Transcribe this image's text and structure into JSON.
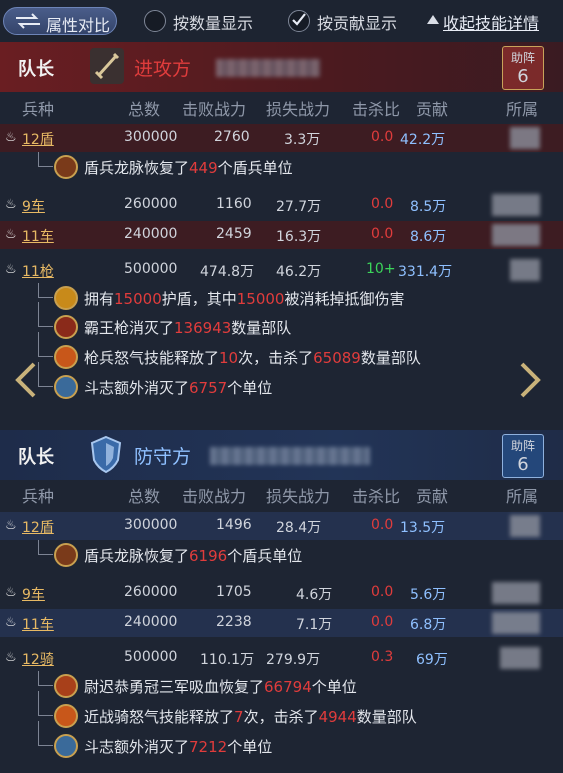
{
  "topbar": {
    "attr_compare": "属性对比",
    "by_count": "按数量显示",
    "by_contrib": "按贡献显示",
    "collapse": "收起技能详情"
  },
  "columns": [
    "兵种",
    "总数",
    "击败战力",
    "损失战力",
    "击杀比",
    "贡献",
    "所属"
  ],
  "attacker": {
    "captain": "队长",
    "side": "进攻方",
    "assist_label": "助阵",
    "assist_count": "6",
    "rows": [
      {
        "unit": "12盾",
        "total": "300000",
        "defeated": "2760",
        "lost": "3.3万",
        "ratio": "0.0",
        "contrib": "42.2万"
      },
      {
        "unit": "9车",
        "total": "260000",
        "defeated": "1160",
        "lost": "27.7万",
        "ratio": "0.0",
        "contrib": "8.5万"
      },
      {
        "unit": "11车",
        "total": "240000",
        "defeated": "2459",
        "lost": "16.3万",
        "ratio": "0.0",
        "contrib": "8.6万"
      },
      {
        "unit": "11枪",
        "total": "500000",
        "defeated": "474.8万",
        "lost": "46.2万",
        "ratio": "10+",
        "contrib": "331.4万"
      }
    ],
    "shield_skill": {
      "pre": "盾兵龙脉恢复了",
      "num": "449",
      "post": "个盾兵单位"
    },
    "spear_skills": [
      {
        "pre": "拥有",
        "num": "15000",
        "mid": "护盾，其中",
        "num2": "15000",
        "post": "被消耗掉抵御伤害"
      },
      {
        "pre": "霸王枪消灭了",
        "num": "136943",
        "post": "数量部队"
      },
      {
        "pre": "枪兵怒气技能释放了",
        "num": "10",
        "mid": "次，击杀了",
        "num2": "65089",
        "post": "数量部队"
      },
      {
        "pre": "斗志额外消灭了",
        "num": "6757",
        "post": "个单位"
      }
    ]
  },
  "defender": {
    "captain": "队长",
    "side": "防守方",
    "assist_label": "助阵",
    "assist_count": "6",
    "rows": [
      {
        "unit": "12盾",
        "total": "300000",
        "defeated": "1496",
        "lost": "28.4万",
        "ratio": "0.0",
        "contrib": "13.5万"
      },
      {
        "unit": "9车",
        "total": "260000",
        "defeated": "1705",
        "lost": "4.6万",
        "ratio": "0.0",
        "contrib": "5.6万"
      },
      {
        "unit": "11车",
        "total": "240000",
        "defeated": "2238",
        "lost": "7.1万",
        "ratio": "0.0",
        "contrib": "6.8万"
      },
      {
        "unit": "12骑",
        "total": "500000",
        "defeated": "110.1万",
        "lost": "279.9万",
        "ratio": "0.3",
        "contrib": "69万"
      }
    ],
    "shield_skill": {
      "pre": "盾兵龙脉恢复了",
      "num": "6196",
      "post": "个盾兵单位"
    },
    "cav_skills": [
      {
        "pre": "尉迟恭勇冠三军吸血恢复了",
        "num": "66794",
        "post": "个单位"
      },
      {
        "pre": "近战骑怒气技能释放了",
        "num": "7",
        "mid": "次，击杀了",
        "num2": "4944",
        "post": "数量部队"
      },
      {
        "pre": "斗志额外消灭了",
        "num": "7212",
        "post": "个单位"
      }
    ]
  },
  "icons": {
    "fire": "fire-icon",
    "sword": "sword-icon",
    "shield": "shield-icon",
    "arrow_left": "chevron-left-icon",
    "arrow_right": "chevron-right-icon"
  }
}
